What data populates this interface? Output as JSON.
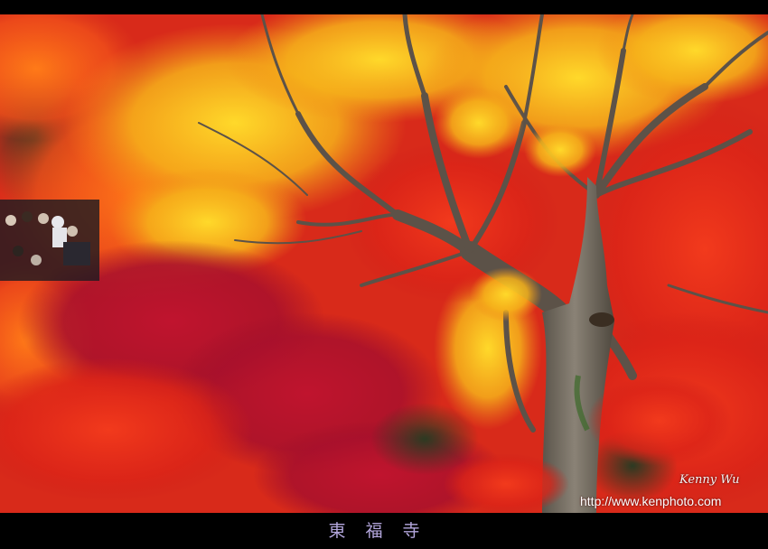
{
  "photo": {
    "subject": "autumn-maple-foliage",
    "colors": {
      "red": "#d8201c",
      "crimson": "#b0102c",
      "orange": "#f05a14",
      "yellow": "#f4c21a",
      "trunk": "#6e665a",
      "frame": "#000000"
    }
  },
  "credits": {
    "signature": "Kenny Wu",
    "url": "http://www.kenphoto.com"
  },
  "caption": {
    "text": "東福寺"
  }
}
